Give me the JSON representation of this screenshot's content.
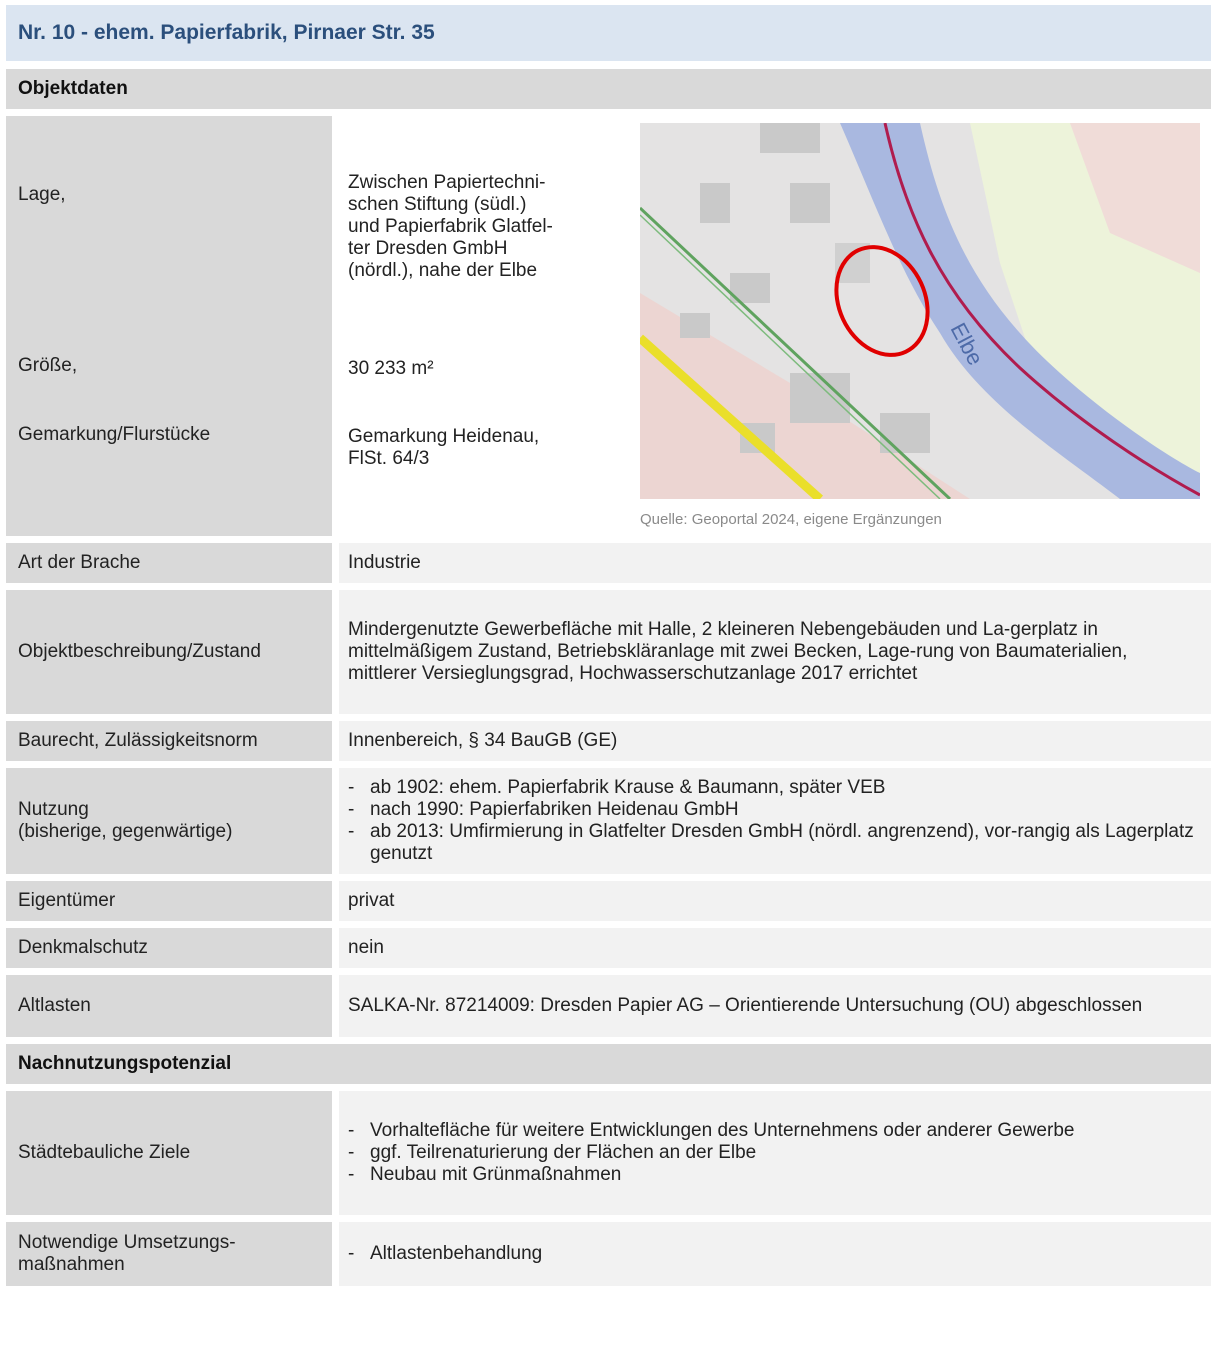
{
  "title": "Nr. 10 - ehem. Papierfabrik, Pirnaer Str. 35",
  "section_objektdaten": "Objektdaten",
  "objekt": {
    "lage_label": "Lage,",
    "groesse_label": "Größe,",
    "gemarkung_label": "Gemarkung/Flurstücke",
    "lage_value": "Zwischen Papiertechni-schen Stiftung (südl.) und Papierfabrik Glatfel-ter Dresden GmbH (nördl.), nahe der Elbe",
    "lage_lines": [
      "Zwischen Papiertechni-",
      "schen Stiftung (südl.)",
      "und Papierfabrik Glatfel-",
      "ter Dresden GmbH",
      "(nördl.), nahe der Elbe"
    ],
    "groesse_value": "30 233 m²",
    "gemarkung_lines": [
      "Gemarkung Heidenau,",
      "FlSt. 64/3"
    ],
    "map_river_label": "Elbe",
    "map_caption": "Quelle: Geoportal 2024, eigene Ergänzungen"
  },
  "rows": {
    "art_label": "Art der Brache",
    "art_value": "Industrie",
    "beschreibung_label": "Objektbeschreibung/Zustand",
    "beschreibung_value": "Mindergenutzte Gewerbefläche mit Halle, 2 kleineren Nebengebäuden und La-gerplatz in mittelmäßigem Zustand, Betriebskläranlage mit zwei Becken, Lage-rung von Baumaterialien, mittlerer Versieglungsgrad, Hochwasserschutzanlage 2017 errichtet",
    "baurecht_label": "Baurecht, Zulässigkeitsnorm",
    "baurecht_value": "Innenbereich, § 34 BauGB (GE)",
    "nutzung_label_1": "Nutzung",
    "nutzung_label_2": "(bisherige, gegenwärtige)",
    "nutzung_items": [
      "ab 1902: ehem. Papierfabrik Krause & Baumann, später VEB",
      "nach 1990: Papierfabriken Heidenau GmbH",
      "ab 2013: Umfirmierung in Glatfelter Dresden GmbH (nördl. angrenzend), vor-rangig als Lagerplatz genutzt"
    ],
    "eigentuemer_label": "Eigentümer",
    "eigentuemer_value": "privat",
    "denkmal_label": "Denkmalschutz",
    "denkmal_value": "nein",
    "altlasten_label": "Altlasten",
    "altlasten_value": "SALKA-Nr. 87214009: Dresden Papier AG – Orientierende Untersuchung (OU) abgeschlossen"
  },
  "section_nachnutzung": "Nachnutzungspotenzial",
  "nachnutzung": {
    "ziele_label": "Städtebauliche Ziele",
    "ziele_items": [
      "Vorhaltefläche für weitere Entwicklungen des Unternehmens oder anderer Gewerbe",
      "ggf. Teilrenaturierung der Flächen an der Elbe",
      "Neubau mit Grünmaßnahmen"
    ],
    "massnahmen_label": "Notwendige Umsetzungs-maßnahmen",
    "massnahmen_items": [
      "Altlastenbehandlung"
    ]
  }
}
